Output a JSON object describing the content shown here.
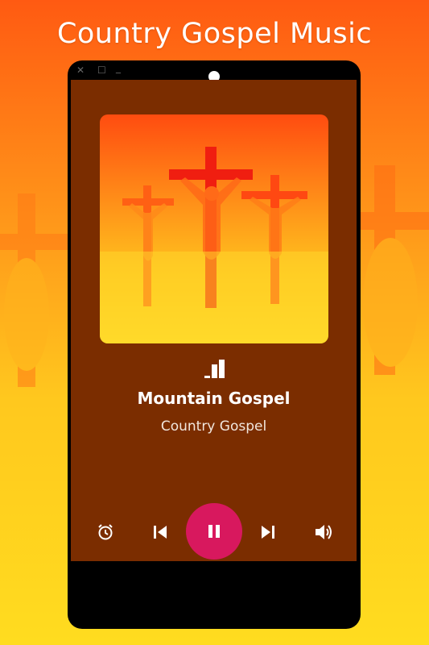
{
  "promo": {
    "title": "Country Gospel Music"
  },
  "player": {
    "song_title": "Mountain Gospel",
    "artist": "Country Gospel",
    "state": "playing"
  },
  "icons": {
    "window": [
      "close-icon",
      "maximize-icon",
      "minimize-icon"
    ],
    "status": "equalizer-icon",
    "controls": [
      "alarm-icon",
      "skip-previous-icon",
      "pause-icon",
      "skip-next-icon",
      "volume-icon"
    ]
  },
  "colors": {
    "screen_bg": "#7b2d00",
    "accent_button": "#d8185e",
    "text": "#ffffff"
  }
}
